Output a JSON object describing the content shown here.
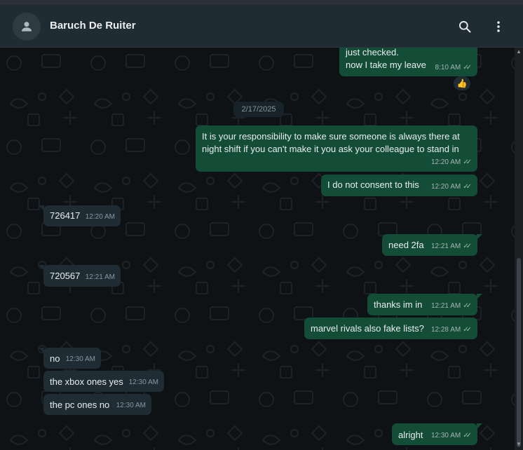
{
  "header": {
    "contact_name": "Baruch De Ruiter",
    "avatar_icon": "person-icon",
    "search_icon": "search-icon",
    "menu_icon": "kebab-menu-icon"
  },
  "colors": {
    "header_bg": "#202c33",
    "chat_bg": "#0e1215",
    "outgoing_bubble": "#134d37",
    "incoming_bubble": "#202c33",
    "text": "#e9edef",
    "meta_text": "#8696a0"
  },
  "chat": {
    "date_separator": "2/17/2025",
    "messages": [
      {
        "dir": "out",
        "text_line1": "just checked.",
        "text_line2": "now I take my leave",
        "time": "8:10 AM",
        "status_icon": "double-check-icon",
        "reaction": "👍"
      },
      {
        "dir": "out",
        "text_line1": "It is your responsibility to make sure someone is always there at",
        "text_line2": "night shift if you can't make it you ask your colleague to stand in",
        "time": "12:20 AM",
        "status_icon": "double-check-icon"
      },
      {
        "dir": "out",
        "text": "I do not consent to this",
        "time": "12:20 AM",
        "status_icon": "double-check-icon"
      },
      {
        "dir": "in",
        "text": "726417",
        "time": "12:20 AM"
      },
      {
        "dir": "out",
        "text": "need 2fa",
        "time": "12:21 AM",
        "status_icon": "double-check-icon"
      },
      {
        "dir": "in",
        "text": "720567",
        "time": "12:21 AM"
      },
      {
        "dir": "out",
        "text": "thanks im in",
        "time": "12:21 AM",
        "status_icon": "double-check-icon"
      },
      {
        "dir": "out",
        "text": "marvel rivals also fake lists?",
        "time": "12:28 AM",
        "status_icon": "double-check-icon"
      },
      {
        "dir": "in",
        "text": "no",
        "time": "12:30 AM"
      },
      {
        "dir": "in",
        "text": "the xbox ones yes",
        "time": "12:30 AM"
      },
      {
        "dir": "in",
        "text": "the pc ones no",
        "time": "12:30 AM"
      },
      {
        "dir": "out",
        "text": "alright",
        "time": "12:30 AM",
        "status_icon": "double-check-icon"
      }
    ]
  }
}
